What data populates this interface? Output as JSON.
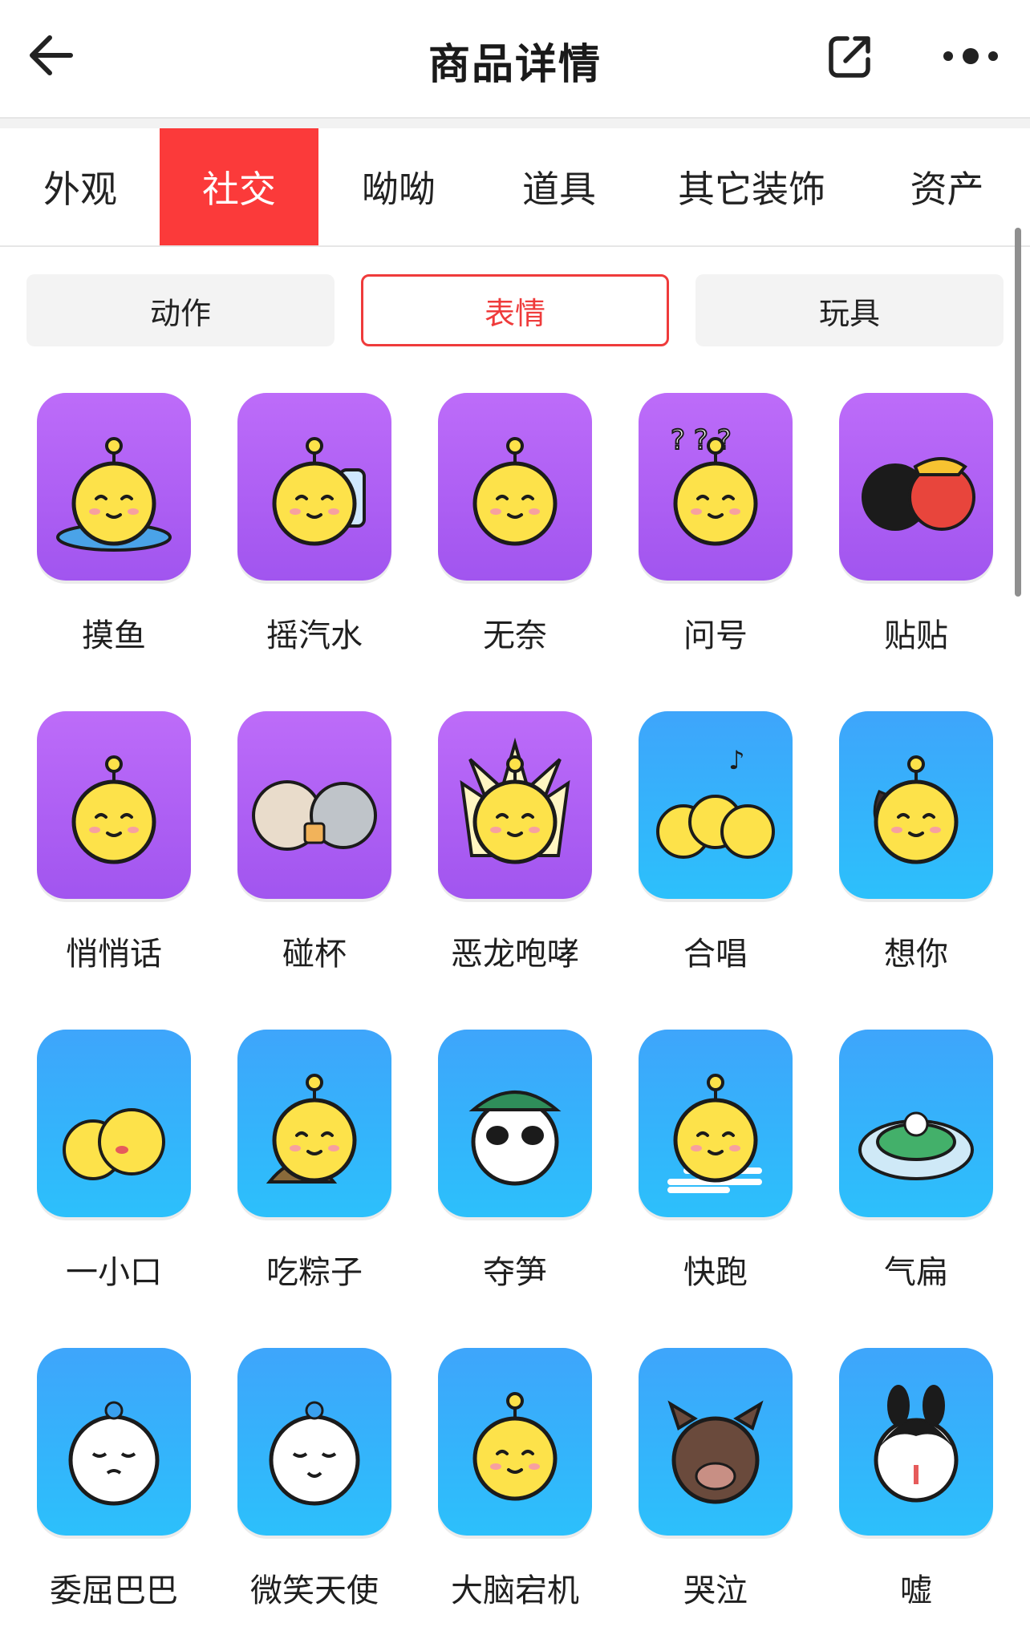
{
  "header": {
    "title": "商品详情"
  },
  "tabs": [
    {
      "label": "外观",
      "active": false
    },
    {
      "label": "社交",
      "active": true
    },
    {
      "label": "呦呦",
      "active": false
    },
    {
      "label": "道具",
      "active": false
    },
    {
      "label": "其它装饰",
      "active": false
    },
    {
      "label": "资产",
      "active": false
    }
  ],
  "subtabs": [
    {
      "label": "动作",
      "active": false
    },
    {
      "label": "表情",
      "active": true
    },
    {
      "label": "玩具",
      "active": false
    }
  ],
  "colors": {
    "accent": "#fb3a3a",
    "purple_tile": "#b163f5",
    "blue_tile": "#35b2fb"
  },
  "items": [
    {
      "label": "摸鱼",
      "tile": "purple"
    },
    {
      "label": "摇汽水",
      "tile": "purple"
    },
    {
      "label": "无奈",
      "tile": "purple"
    },
    {
      "label": "问号",
      "tile": "purple"
    },
    {
      "label": "贴贴",
      "tile": "purple"
    },
    {
      "label": "悄悄话",
      "tile": "purple"
    },
    {
      "label": "碰杯",
      "tile": "purple"
    },
    {
      "label": "恶龙咆哮",
      "tile": "purple"
    },
    {
      "label": "合唱",
      "tile": "blue"
    },
    {
      "label": "想你",
      "tile": "blue"
    },
    {
      "label": "一小口",
      "tile": "blue"
    },
    {
      "label": "吃粽子",
      "tile": "blue"
    },
    {
      "label": "夺笋",
      "tile": "blue"
    },
    {
      "label": "快跑",
      "tile": "blue"
    },
    {
      "label": "气扁",
      "tile": "blue"
    },
    {
      "label": "委屈巴巴",
      "tile": "blue"
    },
    {
      "label": "微笑天使",
      "tile": "blue"
    },
    {
      "label": "大脑宕机",
      "tile": "blue"
    },
    {
      "label": "哭泣",
      "tile": "blue"
    },
    {
      "label": "嘘",
      "tile": "blue"
    }
  ]
}
